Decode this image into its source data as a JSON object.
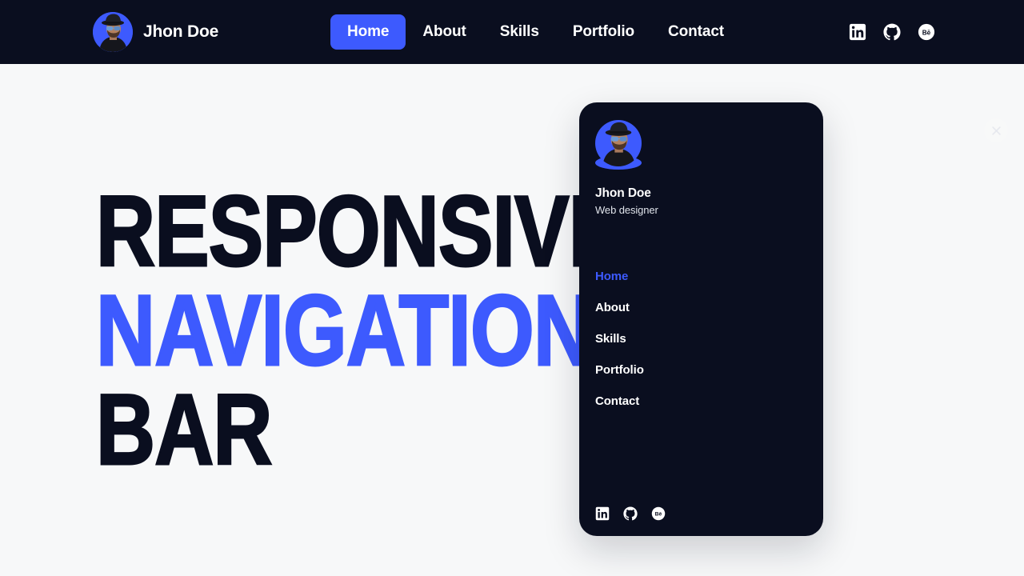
{
  "theme": {
    "page_bg": "#f7f8f9",
    "dark": "#0a0e1f",
    "accent_blue": "#3d5afe",
    "text_light": "#ffffff"
  },
  "navbar": {
    "brand_name": "Jhon Doe",
    "avatar_alt": "avatar",
    "links": [
      {
        "label": "Home",
        "active": true
      },
      {
        "label": "About",
        "active": false
      },
      {
        "label": "Skills",
        "active": false
      },
      {
        "label": "Portfolio",
        "active": false
      },
      {
        "label": "Contact",
        "active": false
      }
    ],
    "socials": [
      {
        "name": "linkedin-icon"
      },
      {
        "name": "github-icon"
      },
      {
        "name": "behance-icon"
      }
    ]
  },
  "hero": {
    "line1": "Responsive",
    "line2": "Navigation",
    "line3": "Bar"
  },
  "sidebar": {
    "close_label": "×",
    "name": "Jhon Doe",
    "role": "Web designer",
    "menu": [
      {
        "label": "Home",
        "active": true
      },
      {
        "label": "About",
        "active": false
      },
      {
        "label": "Skills",
        "active": false
      },
      {
        "label": "Portfolio",
        "active": false
      },
      {
        "label": "Contact",
        "active": false
      }
    ],
    "socials": [
      {
        "name": "linkedin-icon"
      },
      {
        "name": "github-icon"
      },
      {
        "name": "behance-icon"
      }
    ]
  }
}
